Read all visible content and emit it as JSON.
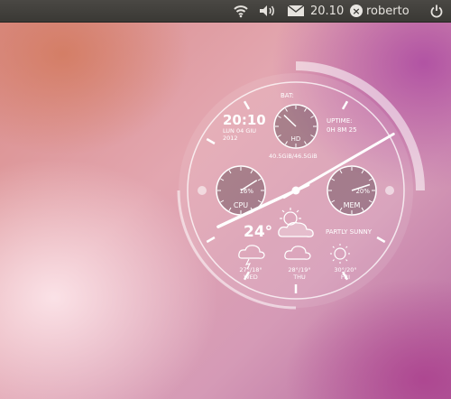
{
  "topbar": {
    "clock": "20.10",
    "username": "roberto",
    "indicators": [
      "wifi-icon",
      "volume-icon",
      "mail-icon",
      "user-status-icon",
      "power-icon"
    ]
  },
  "widget": {
    "battery_label": "BAT:",
    "time": "20:10",
    "date_line1": "LUN 04 GIU",
    "date_line2": "2012",
    "uptime_label": "UPTIME:",
    "uptime_value": "0H 8M 25",
    "hd_label": "HD",
    "hd_usage": "40.5GiB/46.5GiB",
    "cpu_label": "CPU",
    "cpu_value": "16%",
    "mem_label": "MEM",
    "mem_value": "20%",
    "temperature": "24°",
    "condition": "PARTLY SUNNY",
    "forecast": [
      {
        "temps": "27°/18°",
        "day": "WED",
        "icon": "storm-cloud-icon"
      },
      {
        "temps": "28°/19°",
        "day": "THU",
        "icon": "cloud-icon"
      },
      {
        "temps": "30°/20°",
        "day": "FRI",
        "icon": "sun-icon"
      }
    ],
    "clock_hands": {
      "hour": 20,
      "minute": 10
    },
    "gauges": {
      "cpu_percent": 16,
      "mem_percent": 20,
      "hd_used_gib": 40.5,
      "hd_total_gib": 46.5
    }
  }
}
